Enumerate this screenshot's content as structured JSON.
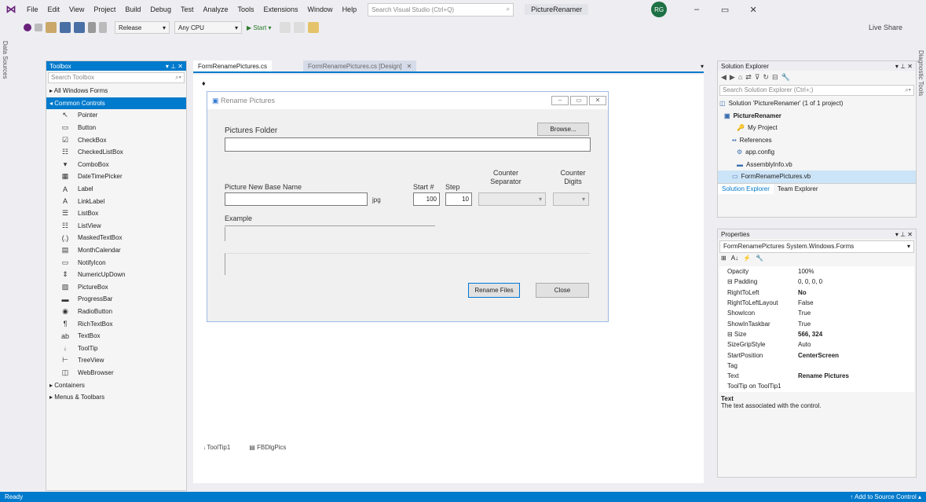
{
  "menubar": {
    "items": [
      "File",
      "Edit",
      "View",
      "Project",
      "Build",
      "Debug",
      "Test",
      "Analyze",
      "Tools",
      "Extensions",
      "Window",
      "Help"
    ],
    "search_placeholder": "Search Visual Studio (Ctrl+Q)",
    "project_name": "PictureRenamer",
    "account_initials": "RG",
    "controls": [
      "–",
      "▭",
      "✕"
    ]
  },
  "toolbar": {
    "config": "Release",
    "platform": "Any CPU",
    "start": "▶ Start ▾",
    "liveshare": "Live Share"
  },
  "left_strip": [
    "Data Sources"
  ],
  "right_strip": [
    "Diagnostic Tools"
  ],
  "toolbox": {
    "title": "Toolbox",
    "search_placeholder": "Search Toolbox",
    "groups_top": [
      "▸ All Windows Forms"
    ],
    "selected_group": "◂ Common Controls",
    "items": [
      {
        "icon": "↖",
        "label": "Pointer"
      },
      {
        "icon": "▭",
        "label": "Button"
      },
      {
        "icon": "☑",
        "label": "CheckBox"
      },
      {
        "icon": "☷",
        "label": "CheckedListBox"
      },
      {
        "icon": "▾",
        "label": "ComboBox"
      },
      {
        "icon": "▦",
        "label": "DateTimePicker"
      },
      {
        "icon": "A",
        "label": "Label"
      },
      {
        "icon": "A",
        "label": "LinkLabel"
      },
      {
        "icon": "☰",
        "label": "ListBox"
      },
      {
        "icon": "☷",
        "label": "ListView"
      },
      {
        "icon": "(.)",
        "label": "MaskedTextBox"
      },
      {
        "icon": "▤",
        "label": "MonthCalendar"
      },
      {
        "icon": "▭",
        "label": "NotifyIcon"
      },
      {
        "icon": "⇕",
        "label": "NumericUpDown"
      },
      {
        "icon": "▨",
        "label": "PictureBox"
      },
      {
        "icon": "▬",
        "label": "ProgressBar"
      },
      {
        "icon": "◉",
        "label": "RadioButton"
      },
      {
        "icon": "¶",
        "label": "RichTextBox"
      },
      {
        "icon": "ab",
        "label": "TextBox"
      },
      {
        "icon": "ᵢ",
        "label": "ToolTip"
      },
      {
        "icon": "⊢",
        "label": "TreeView"
      },
      {
        "icon": "◫",
        "label": "WebBrowser"
      }
    ],
    "groups_bottom": [
      "▸ Containers",
      "▸ Menus & Toolbars"
    ]
  },
  "doc_tabs": {
    "active": "FormRenamePictures.cs",
    "preview": "FormRenamePictures.cs [Design]",
    "preview_close": "✕",
    "dropdown": "▾"
  },
  "form": {
    "title": "Rename Pictures",
    "pictures_folder_label": "Pictures Folder",
    "browse_label": "Browse...",
    "new_name_label": "Picture New Base Name",
    "extension_label": "jpg",
    "start_label": "Start #",
    "start_value": "100",
    "step_label": "Step",
    "step_value": "10",
    "counter_sep_label": "Counter Separator",
    "counter_digits_label": "Counter Digits",
    "example_label": "Example",
    "rename_button": "Rename Files",
    "close_button": "Close"
  },
  "component_tray": [
    "ToolTip1",
    "FBDlgPics"
  ],
  "solution_explorer": {
    "title": "Solution Explorer",
    "search_placeholder": "Search Solution Explorer (Ctrl+;)",
    "rows": [
      {
        "indent": 2,
        "icon": "◫",
        "label": "Solution 'PictureRenamer' (1 of 1 project)",
        "bold": false
      },
      {
        "indent": 8,
        "icon": "▣",
        "label": "PictureRenamer",
        "bold": true
      },
      {
        "indent": 24,
        "icon": "🔑",
        "label": "My Project",
        "bold": false
      },
      {
        "indent": 18,
        "icon": "▪▪",
        "label": "References",
        "bold": false
      },
      {
        "indent": 24,
        "icon": "⚙",
        "label": "app.config",
        "bold": false
      },
      {
        "indent": 24,
        "icon": "▬",
        "label": "AssemblyInfo.vb",
        "bold": false
      },
      {
        "indent": 18,
        "icon": "▭",
        "label": "FormRenamePictures.vb",
        "bold": false
      }
    ],
    "tabs": [
      "Solution Explorer",
      "Team Explorer"
    ]
  },
  "properties": {
    "title": "Properties",
    "object": "FormRenamePictures  System.Windows.Forms",
    "toolbar": [
      "⊞",
      "A↓",
      "⚡",
      "🔧"
    ],
    "rows": [
      {
        "name": "Opacity",
        "value": "100%",
        "bold": false
      },
      {
        "name": "⊟ Padding",
        "value": "0, 0, 0, 0",
        "bold": false
      },
      {
        "name": "RightToLeft",
        "value": "No",
        "bold": true
      },
      {
        "name": "RightToLeftLayout",
        "value": "False",
        "bold": false
      },
      {
        "name": "ShowIcon",
        "value": "True",
        "bold": false
      },
      {
        "name": "ShowInTaskbar",
        "value": "True",
        "bold": false
      },
      {
        "name": "⊟ Size",
        "value": "566, 324",
        "bold": true
      },
      {
        "name": "SizeGripStyle",
        "value": "Auto",
        "bold": false
      },
      {
        "name": "StartPosition",
        "value": "CenterScreen",
        "bold": true
      },
      {
        "name": "Tag",
        "value": "",
        "bold": false
      },
      {
        "name": "Text",
        "value": "Rename Pictures",
        "bold": true
      },
      {
        "name": "ToolTip on ToolTip1",
        "value": "",
        "bold": false
      }
    ],
    "desc_title": "Text",
    "desc_text": "The text associated with the control."
  },
  "statusbar": {
    "left": "Ready",
    "right": "↑ Add to Source Control ▴"
  },
  "colors": {
    "accent": "#007acc",
    "vs_purple": "#68217a"
  }
}
